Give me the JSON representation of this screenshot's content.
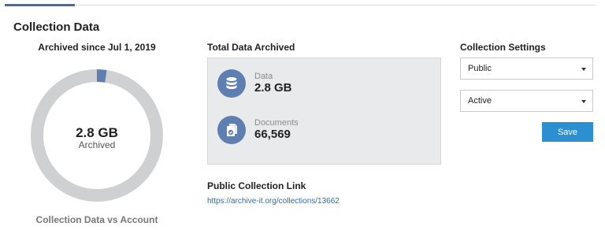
{
  "tabs": {
    "active_color": "#4a6aa0"
  },
  "page": {
    "title": "Collection Data"
  },
  "donut": {
    "title": "Archived since Jul 1, 2019",
    "center_value": "2.8 GB",
    "center_label": "Archived",
    "caption": "Collection Data vs Account",
    "used_fraction": 0.024,
    "used_color": "#5f7fb0",
    "rest_color": "#cfd0d1"
  },
  "total": {
    "title": "Total Data Archived",
    "stats": [
      {
        "label": "Data",
        "value": "2.8 GB",
        "icon": "database-icon"
      },
      {
        "label": "Documents",
        "value": "66,569",
        "icon": "document-check-icon"
      }
    ]
  },
  "link": {
    "title": "Public Collection Link",
    "url": "https://archive-it.org/collections/13662"
  },
  "settings": {
    "title": "Collection Settings",
    "visibility": "Public",
    "status": "Active",
    "save_label": "Save"
  }
}
